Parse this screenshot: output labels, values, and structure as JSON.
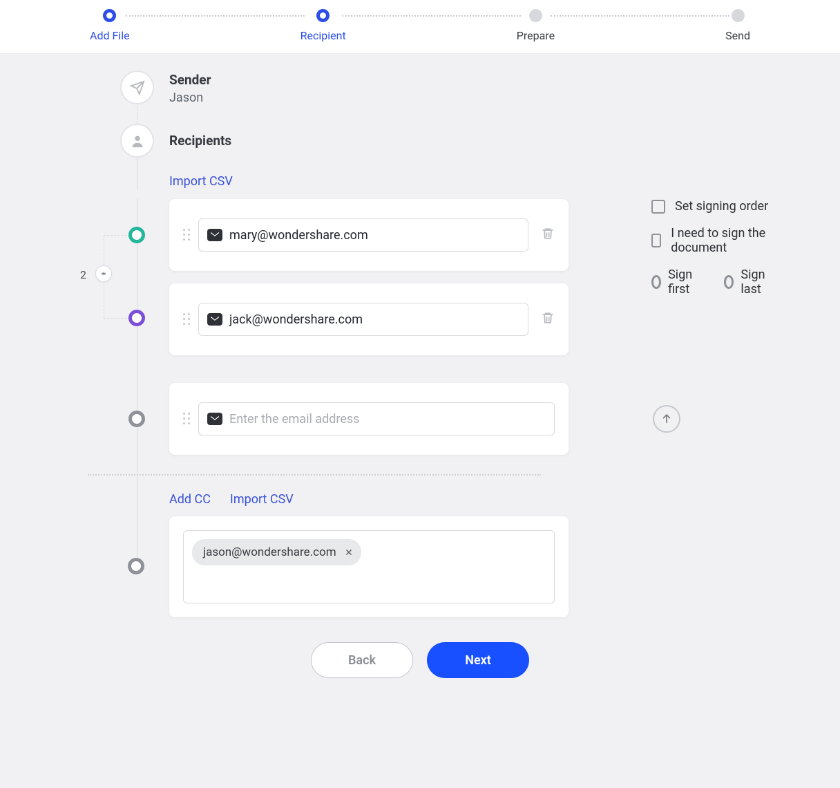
{
  "stepper": {
    "steps": [
      {
        "label": "Add File",
        "active": true
      },
      {
        "label": "Recipient",
        "active": true
      },
      {
        "label": "Prepare",
        "active": false
      },
      {
        "label": "Send",
        "active": false
      }
    ]
  },
  "sender": {
    "heading": "Sender",
    "name": "Jason"
  },
  "recipients": {
    "heading": "Recipients",
    "import_label": "Import CSV",
    "group_count": "2",
    "items": [
      {
        "email": "mary@wondershare.com",
        "node_color": "teal"
      },
      {
        "email": "jack@wondershare.com",
        "node_color": "violet"
      }
    ],
    "empty_placeholder": "Enter the email address"
  },
  "options": {
    "set_order": "Set signing order",
    "need_sign": "I need to sign the document",
    "sign_first": "Sign first",
    "sign_last": "Sign last"
  },
  "cc": {
    "add_label": "Add CC",
    "import_label": "Import CSV",
    "chips": [
      {
        "email": "jason@wondershare.com"
      }
    ]
  },
  "footer": {
    "back": "Back",
    "next": "Next"
  }
}
